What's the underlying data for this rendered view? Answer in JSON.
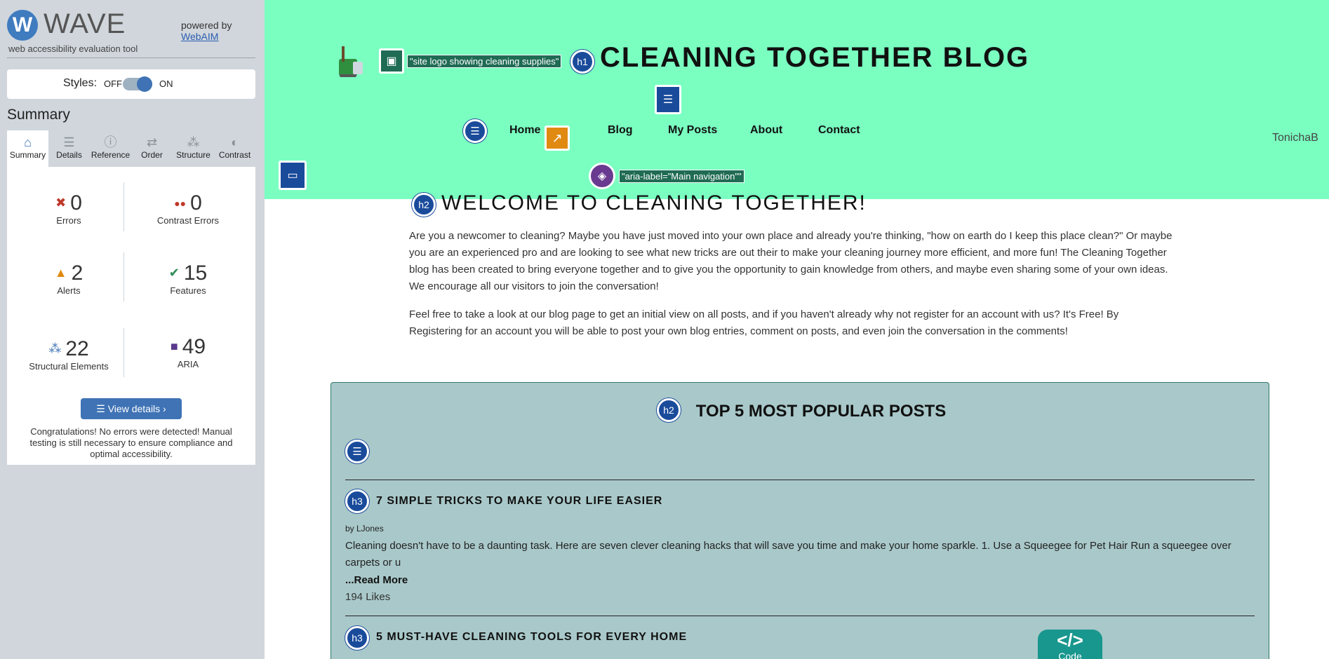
{
  "wave": {
    "logo_letter": "W",
    "brand": "WAVE",
    "tagline": "web accessibility evaluation tool",
    "powered_by": "powered by",
    "webaim": "WebAIM",
    "styles_label": "Styles:",
    "styles_off": "OFF",
    "styles_on": "ON",
    "summary_title": "Summary",
    "tabs": [
      {
        "label": "Summary",
        "icon": "home-icon",
        "glyph": "⌂"
      },
      {
        "label": "Details",
        "icon": "list-icon",
        "glyph": "☰"
      },
      {
        "label": "Reference",
        "icon": "info-icon",
        "glyph": "ⓘ"
      },
      {
        "label": "Order",
        "icon": "order-icon",
        "glyph": "⇄"
      },
      {
        "label": "Structure",
        "icon": "structure-icon",
        "glyph": "⁂"
      },
      {
        "label": "Contrast",
        "icon": "contrast-icon",
        "glyph": "◐"
      }
    ],
    "stats": {
      "errors": {
        "value": "0",
        "label": "Errors",
        "glyph": "✖",
        "color": "#c0392b"
      },
      "contrast": {
        "value": "0",
        "label": "Contrast Errors",
        "glyph": "●●",
        "color": "#c0392b"
      },
      "alerts": {
        "value": "2",
        "label": "Alerts",
        "glyph": "▲",
        "color": "#e08a12"
      },
      "features": {
        "value": "15",
        "label": "Features",
        "glyph": "✔",
        "color": "#2e8b57"
      },
      "structural": {
        "value": "22",
        "label": "Structural Elements",
        "glyph": "⁂",
        "color": "#3f73b5"
      },
      "aria": {
        "value": "49",
        "label": "ARIA",
        "glyph": "■",
        "color": "#5a3a8c"
      }
    },
    "view_details": "View details ›",
    "congrats": "Congratulations! No errors were detected! Manual testing is still necessary to ensure compliance and optimal accessibility."
  },
  "site": {
    "title": "CLEANING TOGETHER BLOG",
    "logo_label": "\"site logo showing cleaning supplies\"",
    "nav_label": "\"aria-label=\"Main navigation\"\"",
    "nav": [
      "Home",
      "Blog",
      "My Posts",
      "About",
      "Contact"
    ],
    "username": "TonichaB"
  },
  "main": {
    "welcome": "WELCOME TO CLEANING TOGETHER!",
    "para1": "Are you a newcomer to cleaning? Maybe you have just moved into your own place and already you're thinking, \"how on earth do I keep this place clean?\" Or maybe you are an experienced pro and are looking to see what new tricks are out their to make your cleaning journey more efficient, and more fun! The Cleaning Together blog has been created to bring everyone together and to give you the opportunity to gain knowledge from others, and maybe even sharing some of your own ideas. We encourage all our visitors to join the conversation!",
    "para2": "Feel free to take a look at our blog page to get an initial view on all posts, and if you haven't already why not register for an account with us? It's Free! By Registering for an account you will be able to post your own blog entries, comment on posts, and even join the conversation in the comments!"
  },
  "popular": {
    "title": "TOP 5 MOST POPULAR POSTS",
    "posts": [
      {
        "title": "7 SIMPLE TRICKS TO MAKE YOUR LIFE EASIER",
        "by": "by LJones",
        "excerpt": "Cleaning doesn't have to be a daunting task. Here are seven clever cleaning hacks that will save you time and make your home sparkle. 1. Use a Squeegee for Pet Hair Run a squeegee over carpets or u",
        "read_more": "...Read More",
        "likes": "194 Likes"
      },
      {
        "title": "5 MUST-HAVE CLEANING TOOLS FOR EVERY HOME"
      }
    ]
  },
  "overlay": {
    "h1": "h1",
    "h2": "h2",
    "h3": "h3",
    "code_symbol": "</>",
    "code_label": "Code"
  }
}
